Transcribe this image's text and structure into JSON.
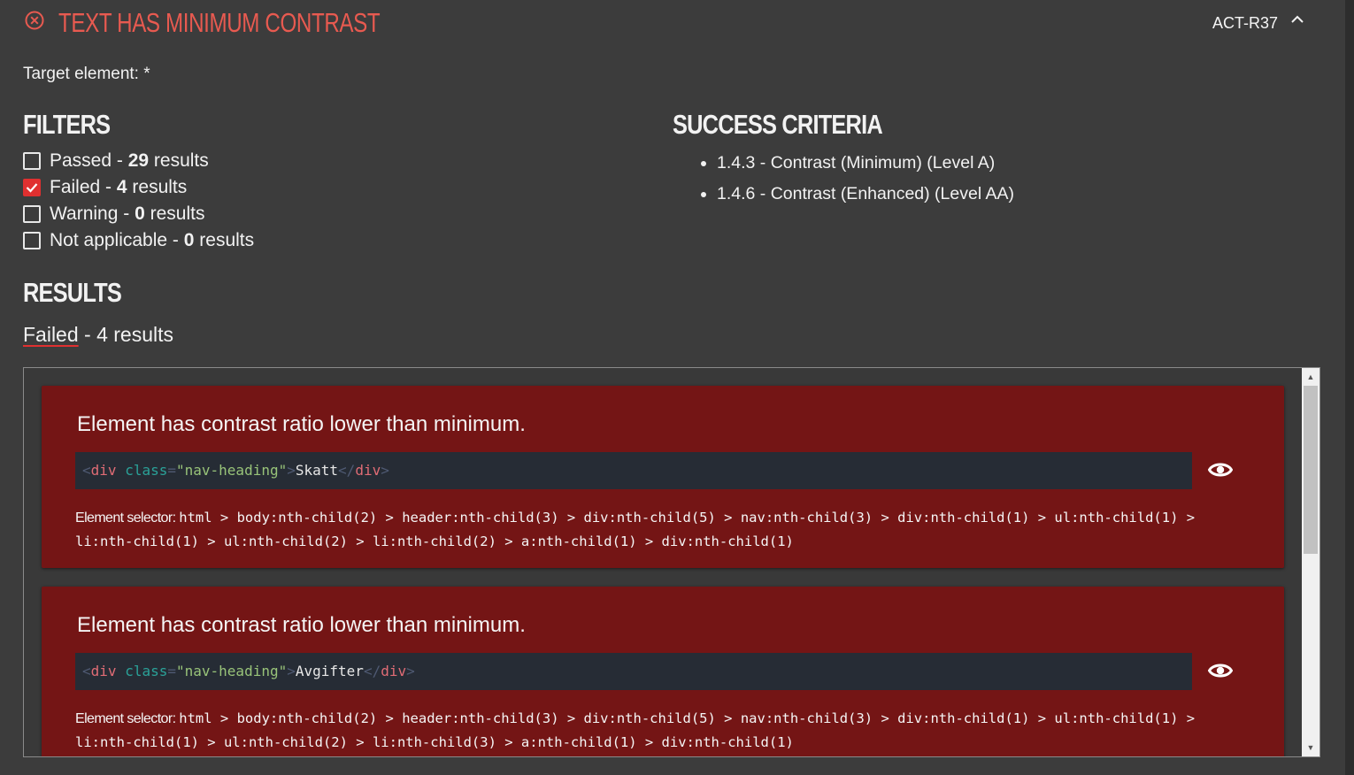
{
  "rule": {
    "title": "TEXT HAS MINIMUM CONTRAST",
    "code": "ACT-R37",
    "status_color": "#e85a50"
  },
  "target": {
    "text": "Target element: *"
  },
  "filters": {
    "heading": "FILTERS",
    "items": [
      {
        "label": "Passed",
        "sep": " - ",
        "count": "29",
        "suffix": " results",
        "checked": false
      },
      {
        "label": "Failed",
        "sep": " - ",
        "count": "4",
        "suffix": " results",
        "checked": true
      },
      {
        "label": "Warning",
        "sep": " - ",
        "count": "0",
        "suffix": " results",
        "checked": false
      },
      {
        "label": "Not applicable",
        "sep": " - ",
        "count": "0",
        "suffix": " results",
        "checked": false
      }
    ]
  },
  "criteria": {
    "heading": "SUCCESS CRITERIA",
    "items": [
      "1.4.3 - Contrast (Minimum) (Level A)",
      "1.4.6 - Contrast (Enhanced) (Level AA)"
    ]
  },
  "results": {
    "heading": "RESULTS",
    "failed_link": "Failed",
    "failed_rest": " - 4 results",
    "cards": [
      {
        "title": "Element has contrast ratio lower than minimum.",
        "code": {
          "tag": "div",
          "attr": "class",
          "value": "\"nav-heading\"",
          "text": "Skatt"
        },
        "selector_label": "Element selector: ",
        "selector_path": "html > body:nth-child(2) > header:nth-child(3) > div:nth-child(5) > nav:nth-child(3) > div:nth-child(1) > ul:nth-child(1) > li:nth-child(1) > ul:nth-child(2) > li:nth-child(2) > a:nth-child(1) > div:nth-child(1)"
      },
      {
        "title": "Element has contrast ratio lower than minimum.",
        "code": {
          "tag": "div",
          "attr": "class",
          "value": "\"nav-heading\"",
          "text": "Avgifter"
        },
        "selector_label": "Element selector: ",
        "selector_path": "html > body:nth-child(2) > header:nth-child(3) > div:nth-child(5) > nav:nth-child(3) > div:nth-child(1) > ul:nth-child(1) > li:nth-child(1) > ul:nth-child(2) > li:nth-child(3) > a:nth-child(1) > div:nth-child(1)"
      }
    ]
  },
  "colors": {
    "card_bg": "#741515",
    "accent": "#e03030",
    "code_bg": "#262c35"
  }
}
